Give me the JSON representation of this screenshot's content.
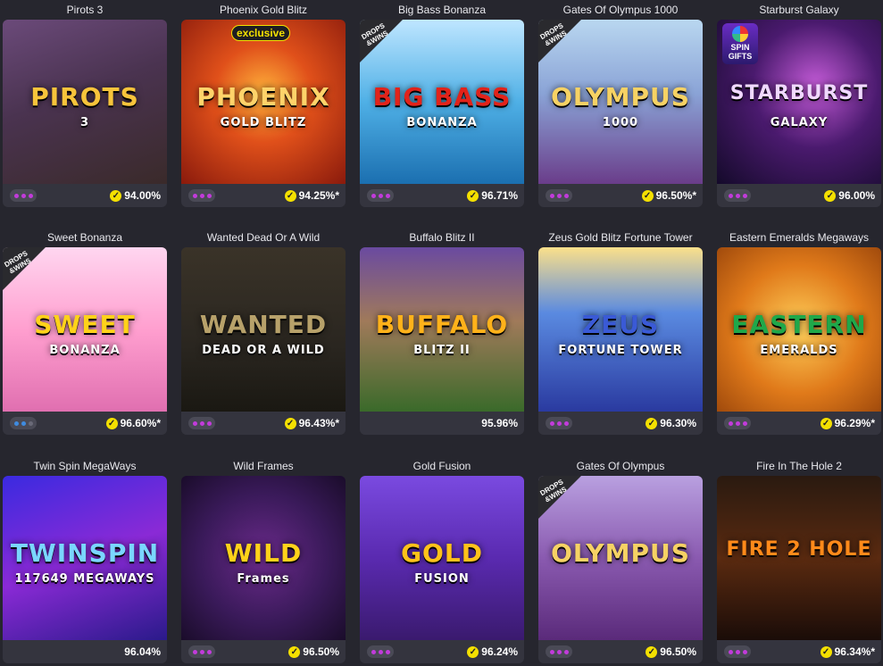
{
  "games": [
    {
      "title": "Pirots 3",
      "rtp": "94.00%",
      "logo": "PIROTS",
      "logo_sub": "3",
      "bg": "linear-gradient(160deg,#6b4a7a 0%,#4a3350 45%,#3a2a2a 100%)",
      "logo_color": "#f7c43b",
      "dots": "purple"
    },
    {
      "title": "Phoenix Gold Blitz",
      "rtp": "94.25%*",
      "logo": "PHOENIX",
      "logo_sub": "GOLD BLITZ",
      "bg": "radial-gradient(circle at 50% 45%,#ffb23b 0%,#e0501a 40%,#8a1a0c 100%)",
      "logo_color": "#ffd36a",
      "badge": "exclusive",
      "dots": "purple"
    },
    {
      "title": "Big Bass Bonanza",
      "rtp": "96.71%",
      "logo": "BIG BASS",
      "logo_sub": "BONANZA",
      "bg": "linear-gradient(180deg,#bfe6ff 0%,#4fb0e6 50%,#1b6fb0 100%)",
      "logo_color": "#e2231a",
      "ribbon": "DROPS &WINS",
      "dots": "purple"
    },
    {
      "title": "Gates Of Olympus 1000",
      "rtp": "96.50%*",
      "logo": "OLYMPUS",
      "logo_sub": "1000",
      "bg": "linear-gradient(180deg,#b9d7f0 0%,#8aa3d6 45%,#6a3d8a 100%)",
      "logo_color": "#f6d264",
      "ribbon": "DROPS &WINS",
      "dots": "purple"
    },
    {
      "title": "Starburst Galaxy",
      "rtp": "96.00%",
      "logo": "STARBURST",
      "logo_sub": "GALAXY",
      "bg": "radial-gradient(circle at 60% 40%,#c25ad6 0%,#4a1a6e 45%,#140a2a 100%)",
      "logo_color": "#f0d8ff",
      "spin": "SPIN GIFTS",
      "dots": "purple"
    },
    {
      "title": "Sweet Bonanza",
      "rtp": "96.60%*",
      "logo": "SWEET",
      "logo_sub": "BONANZA",
      "bg": "linear-gradient(180deg,#ffd6f0 0%,#ff9fcf 50%,#e06fb0 100%)",
      "logo_color": "#ffd21a",
      "ribbon": "DROPS &WINS",
      "dots": "blue"
    },
    {
      "title": "Wanted Dead Or A Wild",
      "rtp": "96.43%*",
      "logo": "WANTED",
      "logo_sub": "DEAD OR A WILD",
      "bg": "linear-gradient(180deg,#3a3328 0%,#2a2620 60%,#1a1812 100%)",
      "logo_color": "#b7a16a",
      "dots": "purple"
    },
    {
      "title": "Buffalo Blitz II",
      "rtp": "95.96%",
      "logo": "BUFFALO",
      "logo_sub": "BLITZ II",
      "bg": "linear-gradient(180deg,#6a4aa0 0%,#a07a5a 45%,#3a6a2a 100%)",
      "logo_color": "#ffb21a",
      "dots": "none"
    },
    {
      "title": "Zeus Gold Blitz Fortune Tower",
      "rtp": "96.30%",
      "logo": "ZEUS",
      "logo_sub": "FORTUNE TOWER",
      "bg": "linear-gradient(180deg,#fbe08a 0%,#5a8ae0 40%,#2a3aa0 100%)",
      "logo_color": "#3a5ad6",
      "dots": "purple"
    },
    {
      "title": "Eastern Emeralds Megaways",
      "rtp": "96.29%*",
      "logo": "EASTERN",
      "logo_sub": "EMERALDS",
      "bg": "radial-gradient(circle at 50% 50%,#ffcf5a 0%,#e07a1a 55%,#a04a0c 100%)",
      "logo_color": "#1fa84a",
      "dots": "purple"
    },
    {
      "title": "Twin Spin MegaWays",
      "rtp": "96.04%",
      "logo": "TWINSPIN",
      "logo_sub": "117649 MEGAWAYS",
      "bg": "linear-gradient(160deg,#3a2ae0 0%,#8a2ad6 50%,#2a1a8a 100%)",
      "logo_color": "#7ad6ff",
      "dots": "none"
    },
    {
      "title": "Wild Frames",
      "rtp": "96.50%",
      "logo": "WILD",
      "logo_sub": "Frames",
      "bg": "radial-gradient(circle at 50% 50%,#6a2a8a 0%,#3a1a5a 55%,#1a0c2a 100%)",
      "logo_color": "#ffd21a",
      "dots": "purple"
    },
    {
      "title": "Gold Fusion",
      "rtp": "96.24%",
      "logo": "GOLD",
      "logo_sub": "FUSION",
      "bg": "linear-gradient(180deg,#7a4ae0 0%,#5a2ab0 50%,#3a1a6e 100%)",
      "logo_color": "#ffc21a",
      "dots": "purple"
    },
    {
      "title": "Gates Of Olympus",
      "rtp": "96.50%",
      "logo": "OLYMPUS",
      "logo_sub": "",
      "bg": "linear-gradient(180deg,#b9a0e0 0%,#8a5ab0 50%,#5a2a7a 100%)",
      "logo_color": "#f6d264",
      "ribbon": "DROPS &WINS",
      "dots": "purple"
    },
    {
      "title": "Fire In The Hole 2",
      "rtp": "96.34%*",
      "logo": "FIRE 2 HOLE",
      "logo_sub": "",
      "bg": "linear-gradient(180deg,#2a1a10 0%,#5a2a10 50%,#1a0c08 100%)",
      "logo_color": "#ff8a1a",
      "dots": "purple"
    }
  ]
}
